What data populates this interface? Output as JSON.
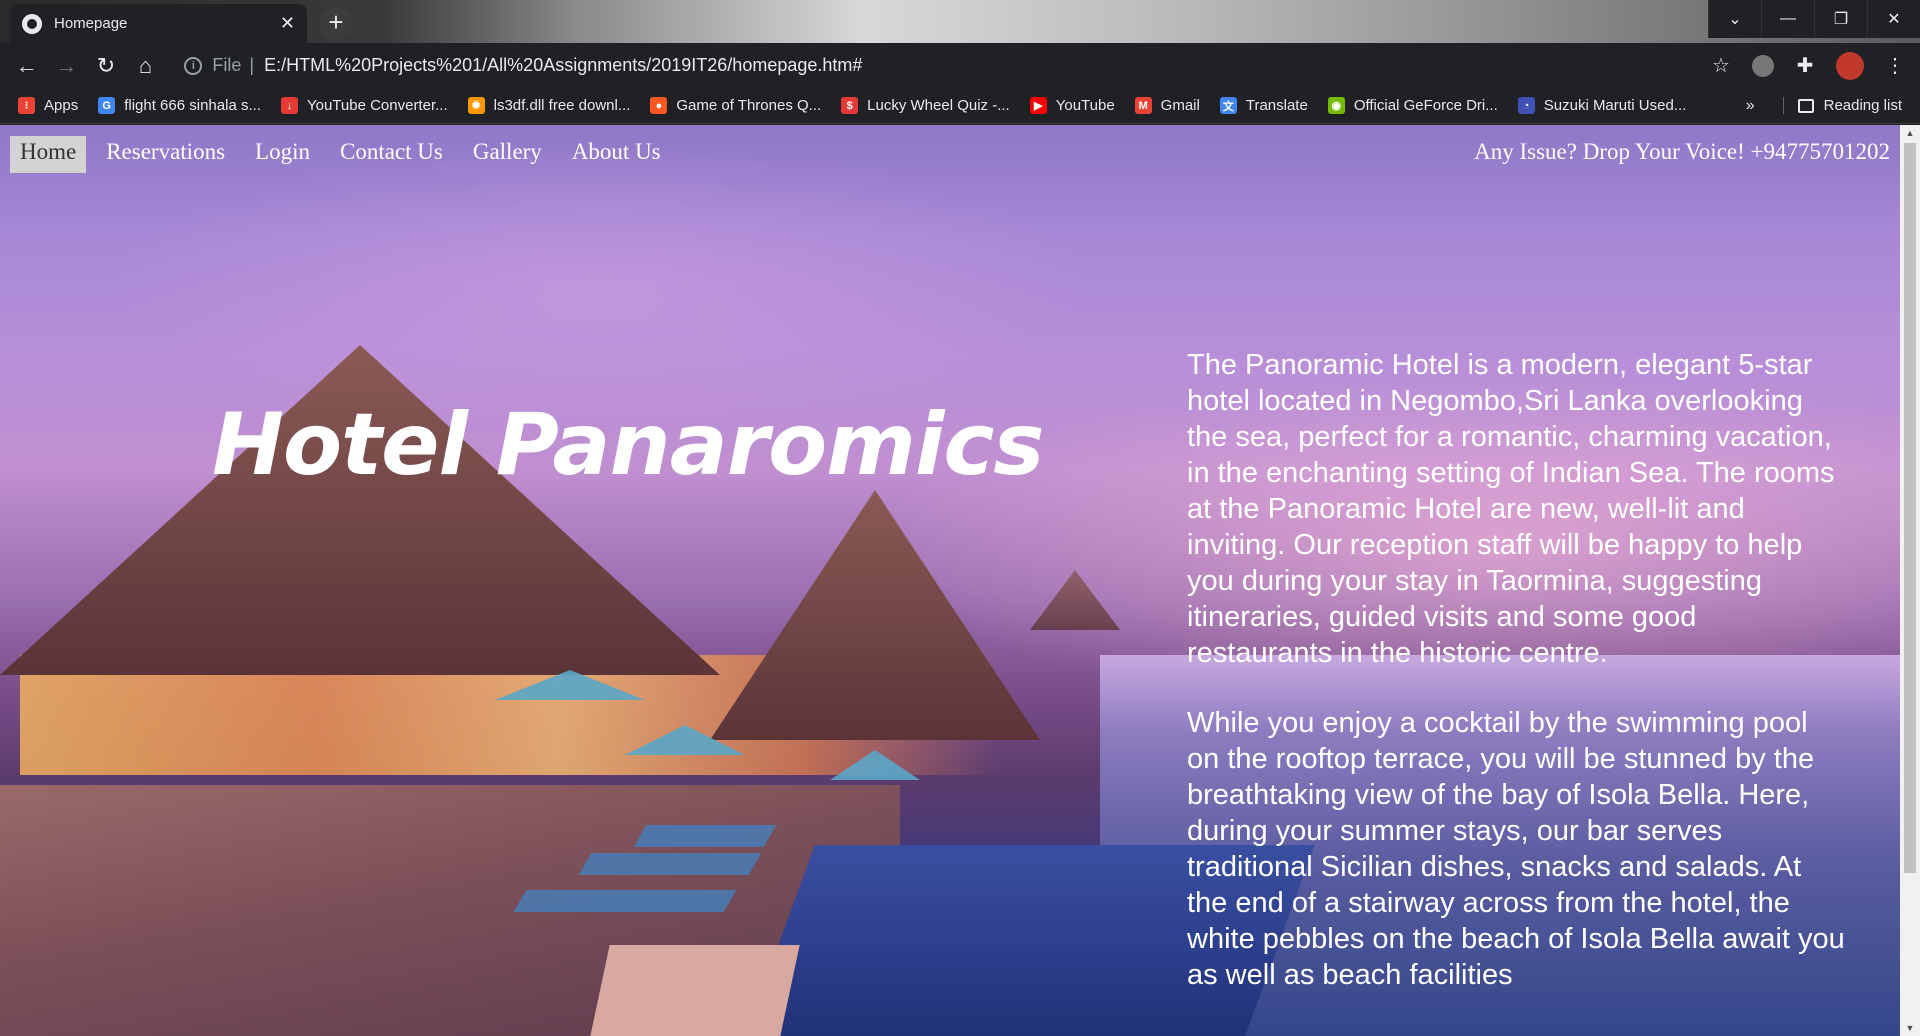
{
  "browser": {
    "tab_title": "Homepage",
    "tab_close": "✕",
    "new_tab": "+",
    "window_controls": {
      "dropdown": "⌄",
      "minimize": "—",
      "restore": "❐",
      "close": "✕"
    },
    "url_scheme": "File",
    "url_separator": "|",
    "url": "E:/HTML%20Projects%201/All%20Assignments/2019IT26/homepage.htm#",
    "bookmarks": [
      {
        "label": "Apps",
        "icon": "apps-grid-icon",
        "color": "#ea4335"
      },
      {
        "label": "flight 666 sinhala s...",
        "icon": "google-icon",
        "color": "#4285f4"
      },
      {
        "label": "YouTube Converter...",
        "icon": "download-icon",
        "color": "#e53935"
      },
      {
        "label": "ls3df.dll free downl...",
        "icon": "gear-icon",
        "color": "#ff9800"
      },
      {
        "label": "Game of Thrones Q...",
        "icon": "reddit-icon",
        "color": "#ff5722"
      },
      {
        "label": "Lucky Wheel Quiz -...",
        "icon": "dollar-icon",
        "color": "#e53935"
      },
      {
        "label": "YouTube",
        "icon": "youtube-icon",
        "color": "#ff0000"
      },
      {
        "label": "Gmail",
        "icon": "gmail-icon",
        "color": "#ea4335"
      },
      {
        "label": "Translate",
        "icon": "translate-icon",
        "color": "#4285f4"
      },
      {
        "label": "Official GeForce Dri...",
        "icon": "nvidia-icon",
        "color": "#76b900"
      },
      {
        "label": "Suzuki Maruti Used...",
        "icon": "car-icon",
        "color": "#3f51b5"
      }
    ],
    "bookmarks_more": "»",
    "reading_list": "Reading list"
  },
  "page": {
    "nav": [
      {
        "label": "Home",
        "active": true
      },
      {
        "label": "Reservations",
        "active": false
      },
      {
        "label": "Login",
        "active": false
      },
      {
        "label": "Contact Us",
        "active": false
      },
      {
        "label": "Gallery",
        "active": false
      },
      {
        "label": "About Us",
        "active": false
      }
    ],
    "hotline": "Any Issue? Drop Your Voice! +94775701202",
    "brand": "Hotel Panaromics",
    "about": [
      "The Panoramic Hotel is a modern, elegant 5-star hotel located in Negombo,Sri Lanka overlooking the sea, perfect for a romantic, charming vacation, in the enchanting setting of Indian Sea. The rooms at the Panoramic Hotel are new, well-lit and inviting. Our reception staff will be happy to help you during your stay in Taormina, suggesting itineraries, guided visits and some good restaurants in the historic centre.",
      "While you enjoy a cocktail by the swimming pool on the rooftop terrace, you will be stunned by the breathtaking view of the bay of Isola Bella. Here, during your summer stays, our bar serves traditional Sicilian dishes, snacks and salads. At the end of a stairway across from the hotel, the white pebbles on the beach of Isola Bella await you as well as beach facilities"
    ]
  }
}
